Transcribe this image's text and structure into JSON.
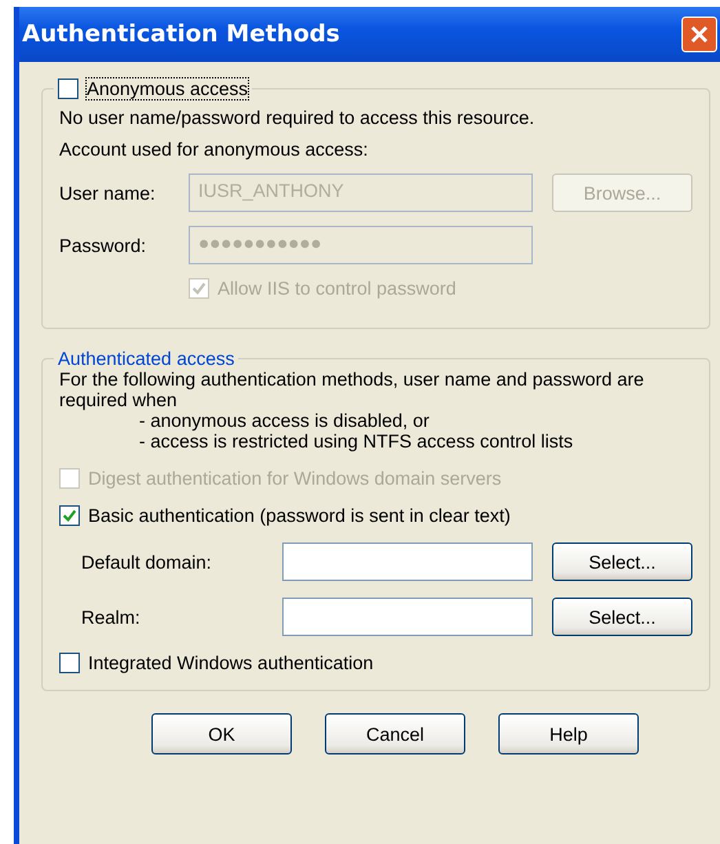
{
  "window": {
    "title": "Authentication Methods"
  },
  "anonymous": {
    "label": "Anonymous access",
    "checked": false,
    "description": "No user name/password required to access this resource.",
    "account_label": "Account used for anonymous access:",
    "fields": [
      {
        "label": "User name:",
        "value": "IUSR_ANTHONY",
        "disabled": true
      },
      {
        "label": "Password:",
        "value": "●●●●●●●●●●●",
        "disabled": true
      }
    ],
    "browse_button": {
      "label": "Browse...",
      "disabled": true
    },
    "allow_option": {
      "label": "Allow IIS to control password",
      "checked": true,
      "disabled": true
    }
  },
  "authenticated": {
    "title": "Authenticated access",
    "description": "For the following authentication methods, user name and password are required when",
    "conditions": [
      "- anonymous access is disabled, or",
      "- access is restricted using NTFS access control lists"
    ],
    "options": [
      {
        "kind": "checkbox",
        "label": "Digest authentication for Windows domain servers",
        "checked": false,
        "disabled": true
      },
      {
        "kind": "checkbox",
        "label": "Basic authentication (password is sent in clear text)",
        "checked": true,
        "disabled": false
      },
      {
        "kind": "field",
        "label": "Default domain:",
        "button": "Select..."
      },
      {
        "kind": "field",
        "label": "Realm:",
        "button": "Select..."
      },
      {
        "kind": "checkbox",
        "label": "Integrated Windows authentication",
        "checked": false,
        "disabled": false
      }
    ]
  },
  "buttons": [
    {
      "label": "OK"
    },
    {
      "label": "Cancel"
    },
    {
      "label": "Help"
    }
  ]
}
